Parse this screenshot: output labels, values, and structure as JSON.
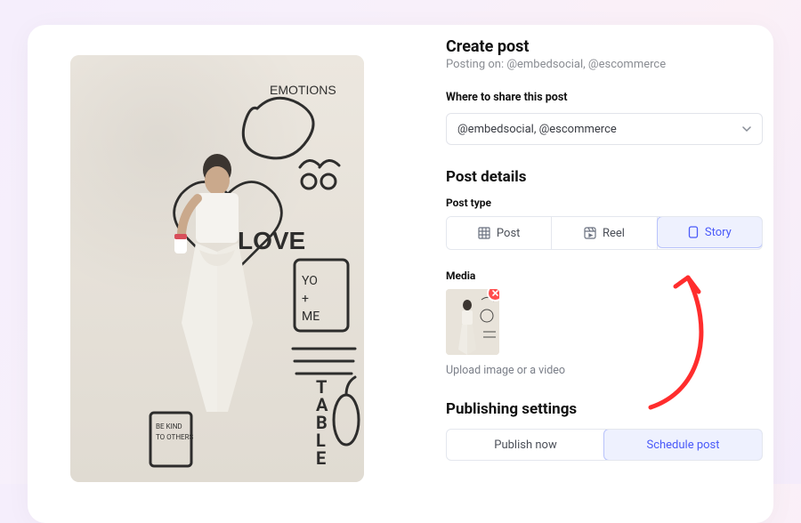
{
  "create": {
    "title": "Create post",
    "posting_on_prefix": "Posting on: ",
    "posting_on_accounts": "@embedsocial, @escommerce"
  },
  "share": {
    "label": "Where to share this post",
    "value": "@embedsocial, @escommerce"
  },
  "details": {
    "heading": "Post details",
    "post_type_label": "Post type",
    "types": [
      {
        "id": "post",
        "label": "Post",
        "icon": "grid-icon"
      },
      {
        "id": "reel",
        "label": "Reel",
        "icon": "reel-icon"
      },
      {
        "id": "story",
        "label": "Story",
        "icon": "phone-icon"
      }
    ],
    "active_type": "story",
    "media_label": "Media",
    "upload_hint": "Upload image or a video"
  },
  "publishing": {
    "heading": "Publishing settings",
    "options": [
      {
        "id": "now",
        "label": "Publish now"
      },
      {
        "id": "schedule",
        "label": "Schedule post"
      }
    ],
    "active": "schedule"
  },
  "colors": {
    "accent": "#4a5af9",
    "danger": "#ff4d4d"
  }
}
